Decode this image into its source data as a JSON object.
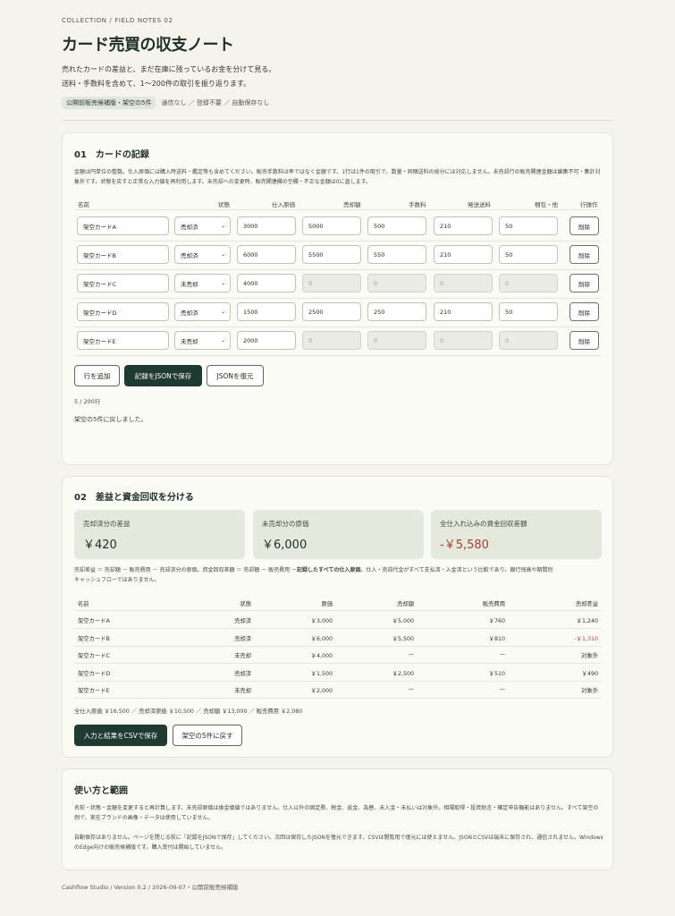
{
  "header": {
    "eyebrow": "COLLECTION / FIELD NOTES 02",
    "title": "カード売買の収支ノート",
    "lead_1": "売れたカードの差益と、まだ在庫に残っているお金を分けて見る。",
    "lead_2": "送料・手数料を含めて、1〜200件の取引を振り返ります。",
    "chip": "公開前販売候補版・架空の5件",
    "chip_note": "通信なし ／ 登録不要 ／ 自動保存なし"
  },
  "records": {
    "title": "01　カードの記録",
    "note": "金額は円単位の整数。仕入原価には購入時送料・鑑定等も含めてください。販売手数料は率ではなく金額です。1行は1件の取引で、数量・同梱送料の按分には対応しません。未売却行の販売関連金額は編集不可・集計対象外です。状態を戻すと正常な入力値を再利用します。未売却への変更時、販売関連欄の空欄・不正な金額は0に直します。",
    "columns": [
      "名前",
      "状態",
      "仕入原価",
      "売却額",
      "手数料",
      "発送送料",
      "梱包・他",
      "行操作"
    ],
    "rows": [
      {
        "name": "架空カードA",
        "status": "売却済",
        "cost": "3000",
        "sale": "5000",
        "fee": "500",
        "ship": "210",
        "pack": "50",
        "sold": true
      },
      {
        "name": "架空カードB",
        "status": "売却済",
        "cost": "6000",
        "sale": "5500",
        "fee": "550",
        "ship": "210",
        "pack": "50",
        "sold": true
      },
      {
        "name": "架空カードC",
        "status": "未売却",
        "cost": "4000",
        "sale": "0",
        "fee": "0",
        "ship": "0",
        "pack": "0",
        "sold": false
      },
      {
        "name": "架空カードD",
        "status": "売却済",
        "cost": "1500",
        "sale": "2500",
        "fee": "250",
        "ship": "210",
        "pack": "50",
        "sold": true
      },
      {
        "name": "架空カードE",
        "status": "未売却",
        "cost": "2000",
        "sale": "0",
        "fee": "0",
        "ship": "0",
        "pack": "0",
        "sold": false
      }
    ],
    "delete_label": "削除",
    "add_row": "行を追加",
    "save_json": "記録をJSONで保存",
    "restore_json": "JSONを復元",
    "count": "5 / 200行",
    "status_message": "架空の5件に戻しました。"
  },
  "summary": {
    "title": "02　差益と資金回収を分ける",
    "stats": [
      {
        "label": "売却済分の差益",
        "value": "￥420"
      },
      {
        "label": "未売却分の原価",
        "value": "￥6,000"
      },
      {
        "label": "全仕入れ込みの資金回収差額",
        "value": "-￥5,580"
      }
    ],
    "formula_1": "売却差益 ＝ 売却額 － 販売費用 － 売却済分の原価。資金回収差額 ＝ 売却額 － 販売費用 －",
    "formula_bold": "記録したすべての仕入原価",
    "formula_2": "。仕入・売却代金がすべて支払済・入金済という比較であり、銀行残高や期間別",
    "formula_3": "キャッシュフローではありません。",
    "columns": [
      "名前",
      "状態",
      "原価",
      "売却額",
      "販売費用",
      "売却差益"
    ],
    "rows": [
      {
        "name": "架空カードA",
        "status": "売却済",
        "cost": "￥3,000",
        "sale": "￥5,000",
        "expense": "￥760",
        "profit": "￥1,240"
      },
      {
        "name": "架空カードB",
        "status": "売却済",
        "cost": "￥6,000",
        "sale": "￥5,500",
        "expense": "￥810",
        "profit": "-￥1,310"
      },
      {
        "name": "架空カードC",
        "status": "未売却",
        "cost": "￥4,000",
        "sale": "—",
        "expense": "—",
        "profit": "対象外"
      },
      {
        "name": "架空カードD",
        "status": "売却済",
        "cost": "￥1,500",
        "sale": "￥2,500",
        "expense": "￥510",
        "profit": "￥490"
      },
      {
        "name": "架空カードE",
        "status": "未売却",
        "cost": "￥2,000",
        "sale": "—",
        "expense": "—",
        "profit": "対象外"
      }
    ],
    "totals": "全仕入原価 ￥16,500 ／ 売却済原価 ￥10,500 ／ 売却額 ￥13,000 ／ 販売費用 ￥2,080",
    "save_csv": "入力と結果をCSVで保存",
    "reset": "架空の5件に戻す"
  },
  "usage": {
    "title": "使い方と範囲",
    "p1": "名前・状態・金額を変更すると再計算します。未売却原価は換金価値ではありません。仕入以外の固定費、税金、返金、為替、未入金・未払いは対象外。相場取得・投資助言・確定申告機能はありません。すべて架空の例で、実在ブランドの画像・データは使用していません。",
    "p2": "自動保存はありません。ページを閉じる前に「記録をJSONで保存」してください。次回は保存したJSONを復元できます。CSVは閲覧用で復元には使えません。JSONとCSVは端末に保存され、通信されません。Windows のEdge向けの販売候補版です。購入受付は開始していません。"
  },
  "footer": "Cashflow Studio / Version 0.2 / 2026-09-07・公開前販売候補版",
  "colors": {
    "accent": "#1f3a30",
    "negative": "#a3432d",
    "background": "#f4f3ec"
  }
}
